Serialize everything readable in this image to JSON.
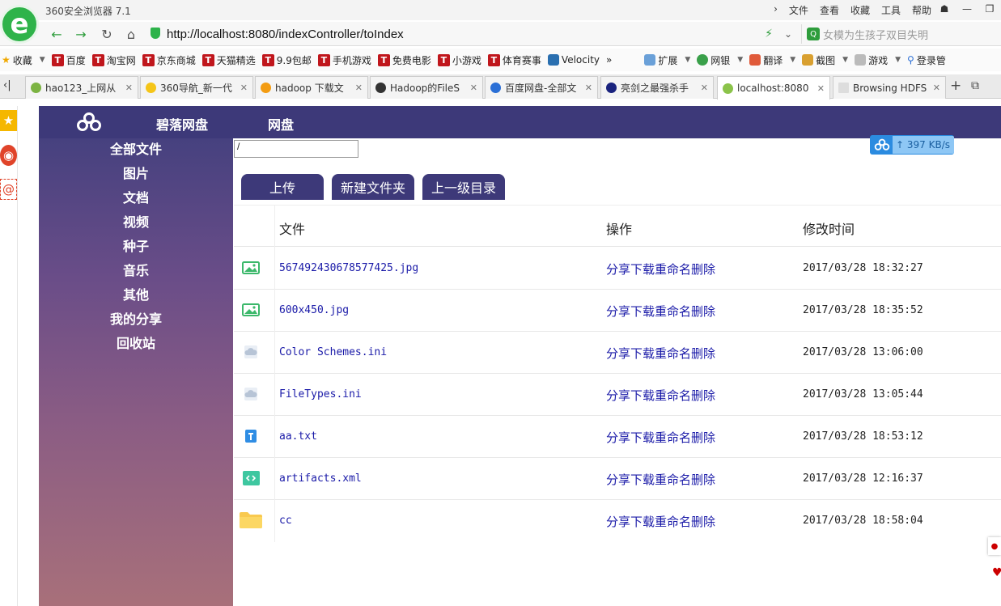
{
  "browser": {
    "title": "360安全浏览器 7.1",
    "menu": [
      "文件",
      "查看",
      "收藏",
      "工具",
      "帮助"
    ],
    "url": "http://localhost:8080/indexController/toIndex",
    "search_placeholder": "女模为生孩子双目失明",
    "logo_glyph": "e",
    "bookmarks": {
      "fav_label": "收藏",
      "items": [
        "百度",
        "淘宝网",
        "京东商城",
        "天猫精选",
        "9.9包邮",
        "手机游戏",
        "免费电影",
        "小游戏",
        "体育赛事",
        "Velocity"
      ],
      "more": "»",
      "tools": [
        "扩展",
        "网银",
        "翻译",
        "截图",
        "游戏",
        "登录管"
      ]
    },
    "tabs": [
      {
        "label": "hao123_上网从",
        "color": "#7cb342"
      },
      {
        "label": "360导航_新一代",
        "color": "#f5c518"
      },
      {
        "label": "hadoop 下载文",
        "color": "#f39c12"
      },
      {
        "label": "Hadoop的FileS",
        "color": "#333333"
      },
      {
        "label": "百度网盘-全部文",
        "color": "#2b6fd6"
      },
      {
        "label": "亮剑之最强杀手",
        "color": "#1a237e"
      },
      {
        "label": "localhost:8080",
        "color": "#8bc34a"
      },
      {
        "label": "Browsing HDFS",
        "color": "#cccccc"
      }
    ],
    "active_tab": 6
  },
  "app": {
    "brand": "碧落网盘",
    "brand_sub": "网盘",
    "sidebar": [
      "全部文件",
      "图片",
      "文档",
      "视频",
      "种子",
      "音乐",
      "其他",
      "我的分享",
      "回收站"
    ],
    "path_value": "/",
    "speed": "397 KB/s",
    "buttons": {
      "upload": "上传",
      "new_folder": "新建文件夹",
      "parent": "上一级目录"
    },
    "columns": {
      "file": "文件",
      "ops": "操作",
      "mtime": "修改时间"
    },
    "op_labels": [
      "分享",
      "下载",
      "重命名",
      "删除"
    ],
    "files": [
      {
        "name": "567492430678577425.jpg",
        "type": "image",
        "mtime": "2017/03/28 18:32:27"
      },
      {
        "name": "600x450.jpg",
        "type": "image",
        "mtime": "2017/03/28 18:35:52"
      },
      {
        "name": "Color Schemes.ini",
        "type": "cloud",
        "mtime": "2017/03/28 13:06:00"
      },
      {
        "name": "FileTypes.ini",
        "type": "cloud",
        "mtime": "2017/03/28 13:05:44"
      },
      {
        "name": "aa.txt",
        "type": "text",
        "mtime": "2017/03/28 18:53:12"
      },
      {
        "name": "artifacts.xml",
        "type": "code",
        "mtime": "2017/03/28 12:16:37"
      },
      {
        "name": "cc",
        "type": "folder",
        "mtime": "2017/03/28 18:58:04"
      }
    ]
  },
  "colors": {
    "header": "#3d3979",
    "link": "#1a1aa8",
    "green": "#2fb34a"
  }
}
